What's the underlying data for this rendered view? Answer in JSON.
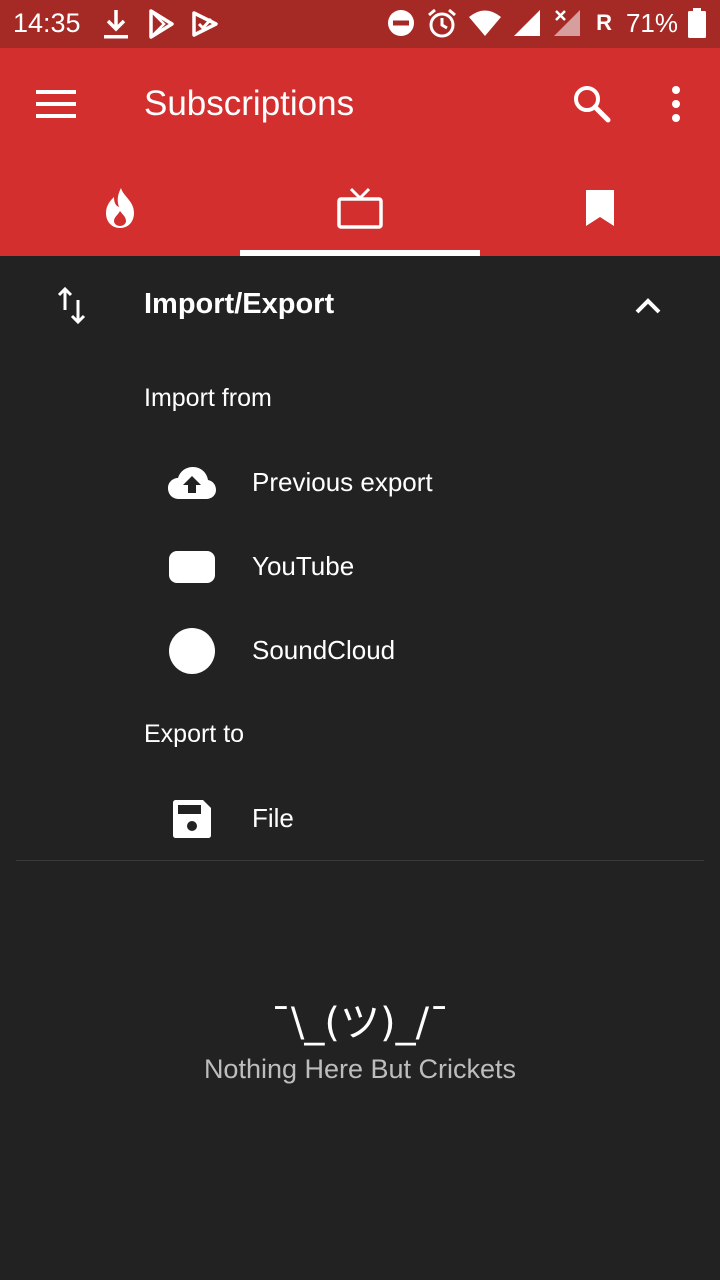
{
  "status_bar": {
    "time": "14:35",
    "left_icons": [
      "download-icon",
      "play-store-icon",
      "play-music-icon"
    ],
    "right_icons": [
      "dnd-icon",
      "alarm-icon",
      "wifi-icon",
      "signal-icon",
      "signal-x-icon"
    ],
    "roaming": "R",
    "battery": "71%"
  },
  "app_bar": {
    "title": "Subscriptions",
    "color": "#d32f2f",
    "tabs": [
      {
        "icon": "fire-icon",
        "name": "trending"
      },
      {
        "icon": "tv-icon",
        "name": "subscriptions",
        "selected": true
      },
      {
        "icon": "bookmark-icon",
        "name": "bookmarks"
      }
    ]
  },
  "import_export": {
    "title": "Import/Export",
    "import_label": "Import from",
    "import_items": [
      {
        "label": "Previous export",
        "icon": "cloud-upload-icon"
      },
      {
        "label": "YouTube",
        "icon": "youtube-icon"
      },
      {
        "label": "SoundCloud",
        "icon": "soundcloud-icon"
      }
    ],
    "export_label": "Export to",
    "export_items": [
      {
        "label": "File",
        "icon": "save-icon"
      }
    ]
  },
  "empty_state": {
    "emoji": "¯\\_(ツ)_/¯",
    "message": "Nothing Here But Crickets"
  }
}
